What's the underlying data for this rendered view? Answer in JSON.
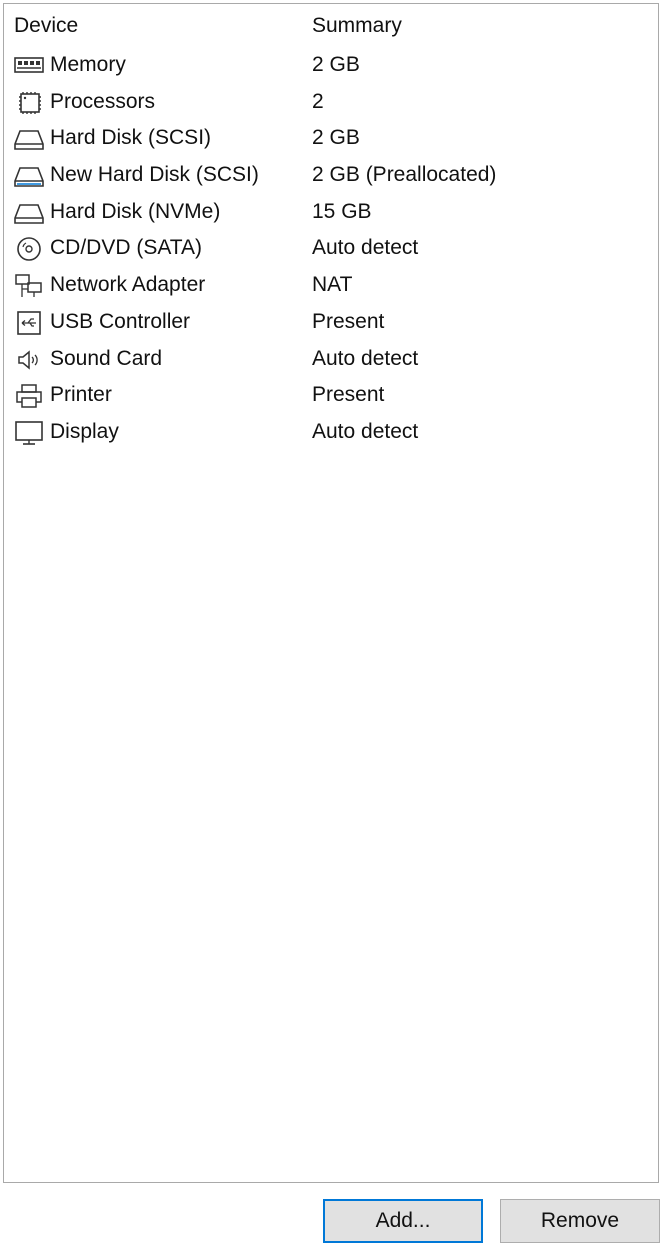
{
  "columns": {
    "device": "Device",
    "summary": "Summary"
  },
  "devices": [
    {
      "name": "Memory",
      "summary": "2 GB",
      "icon": "memory-icon"
    },
    {
      "name": "Processors",
      "summary": "2",
      "icon": "processor-icon"
    },
    {
      "name": "Hard Disk (SCSI)",
      "summary": "2 GB",
      "icon": "hard-disk-icon"
    },
    {
      "name": "New Hard Disk (SCSI)",
      "summary": "2 GB (Preallocated)",
      "icon": "new-hard-disk-icon"
    },
    {
      "name": "Hard Disk (NVMe)",
      "summary": "15 GB",
      "icon": "hard-disk-icon"
    },
    {
      "name": "CD/DVD (SATA)",
      "summary": "Auto detect",
      "icon": "cd-dvd-icon"
    },
    {
      "name": "Network Adapter",
      "summary": "NAT",
      "icon": "network-adapter-icon"
    },
    {
      "name": "USB Controller",
      "summary": "Present",
      "icon": "usb-icon"
    },
    {
      "name": "Sound Card",
      "summary": "Auto detect",
      "icon": "speaker-icon"
    },
    {
      "name": "Printer",
      "summary": "Present",
      "icon": "printer-icon"
    },
    {
      "name": "Display",
      "summary": "Auto detect",
      "icon": "monitor-icon"
    }
  ],
  "buttons": {
    "add": "Add...",
    "remove": "Remove"
  },
  "colors": {
    "focus_border": "#0078d7",
    "button_bg": "#e1e1e1"
  }
}
